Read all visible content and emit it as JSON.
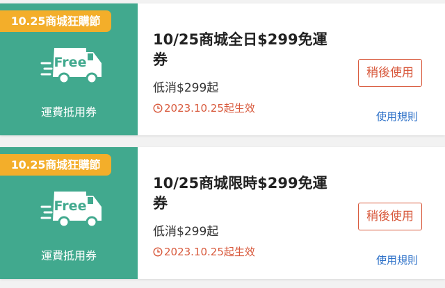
{
  "colors": {
    "stub": "#41a98e",
    "tag": "#f3ae2a",
    "accent": "#d8593c",
    "link": "#2c70c8"
  },
  "coupons": [
    {
      "tag": "10.25商城狂購節",
      "truck_text": "Free",
      "stub_label": "運費抵用券",
      "title": "10/25商城全日$299免運券",
      "condition": "低消$299起",
      "date": "2023.10.25起生效",
      "button": "稍後使用",
      "rules": "使用規則"
    },
    {
      "tag": "10.25商城狂購節",
      "truck_text": "Free",
      "stub_label": "運費抵用券",
      "title": "10/25商城限時$299免運券",
      "condition": "低消$299起",
      "date": "2023.10.25起生效",
      "button": "稍後使用",
      "rules": "使用規則"
    }
  ],
  "icons": {
    "truck": "delivery-truck-icon",
    "clock": "clock-icon"
  }
}
